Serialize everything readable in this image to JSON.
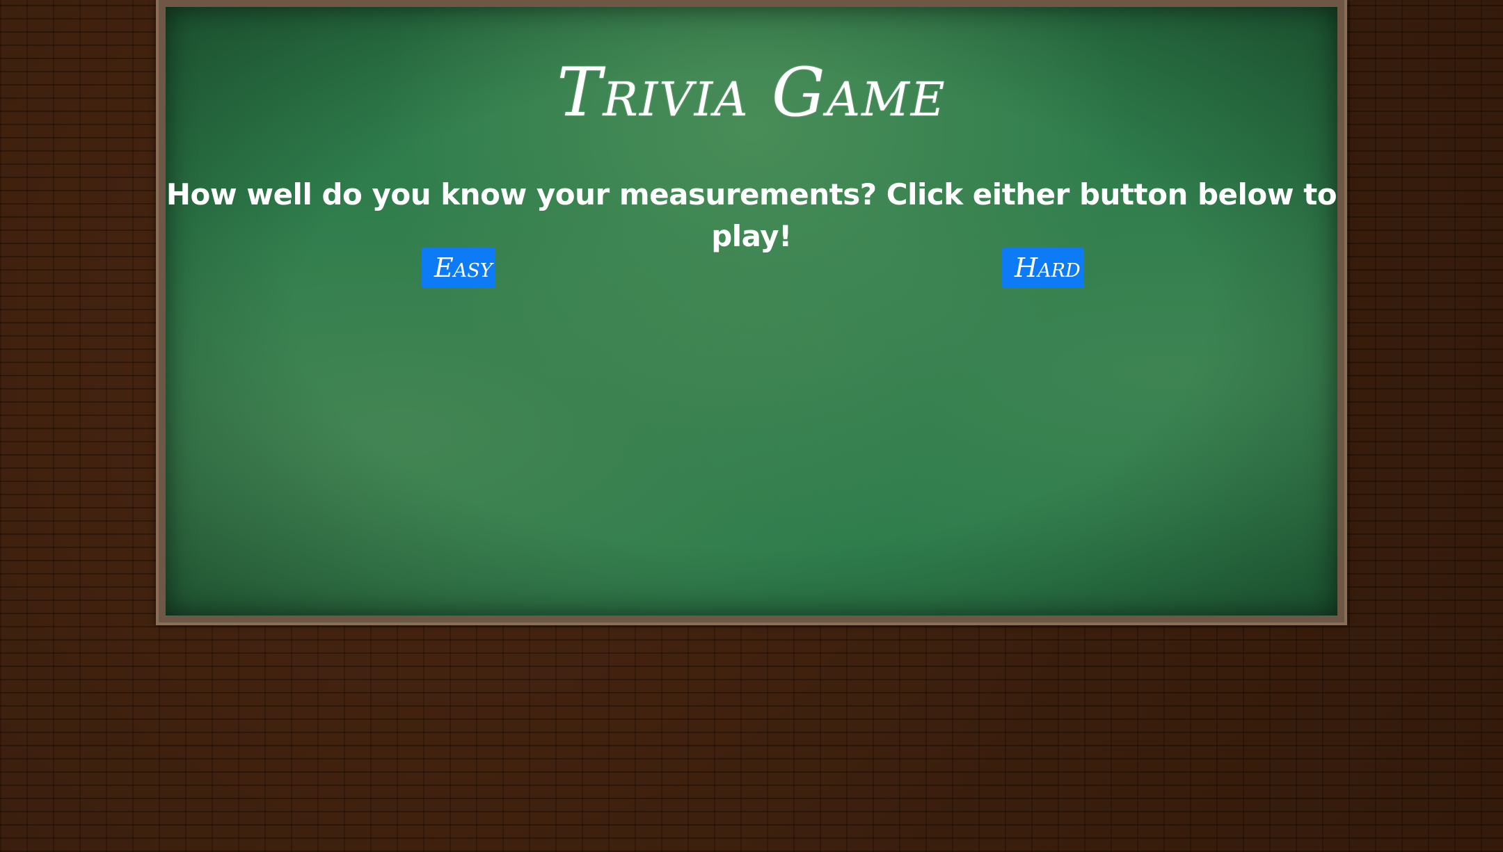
{
  "header": {
    "title": "Trivia Game"
  },
  "intro": {
    "text": "How well do you know your measurements? Click either button below to play!"
  },
  "buttons": {
    "easy_label": "Easy",
    "hard_label": "Hard"
  },
  "colors": {
    "background_brick": "#3b1f0e",
    "frame": "#6e5744",
    "chalkboard": "#2f7d4c",
    "button": "#0d7bf5",
    "text": "#ffffff"
  }
}
